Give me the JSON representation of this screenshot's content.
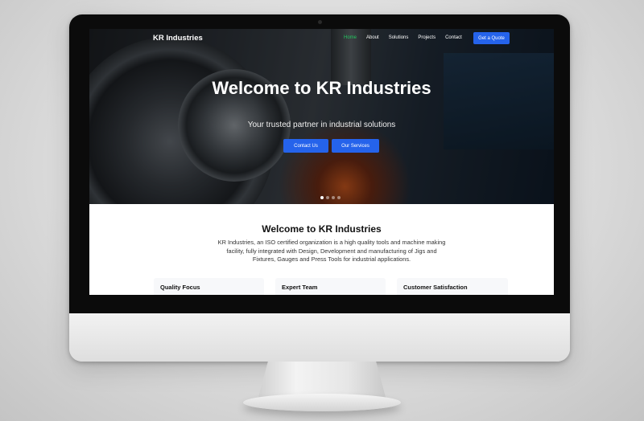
{
  "nav": {
    "brand": "KR Industries",
    "links": [
      "Home",
      "About",
      "Solutions",
      "Projects",
      "Contact"
    ],
    "active_link": "Home",
    "cta": "Get a Quote"
  },
  "hero": {
    "title": "Welcome to KR Industries",
    "subtitle": "Your trusted partner in industrial solutions",
    "buttons": [
      "Contact Us",
      "Our Services"
    ],
    "slide_count": 4,
    "active_slide": 1
  },
  "welcome": {
    "title": "Welcome to KR Industries",
    "body": "KR Industries, an ISO certified organization is a high quality tools and machine making facility, fully integrated with Design, Development and manufacturing of Jigs and Fixtures, Gauges and Press Tools for industrial applications."
  },
  "features": [
    "Quality Focus",
    "Expert Team",
    "Customer Satisfaction"
  ],
  "colors": {
    "accent": "#2563eb",
    "active_nav": "#22c55e"
  }
}
